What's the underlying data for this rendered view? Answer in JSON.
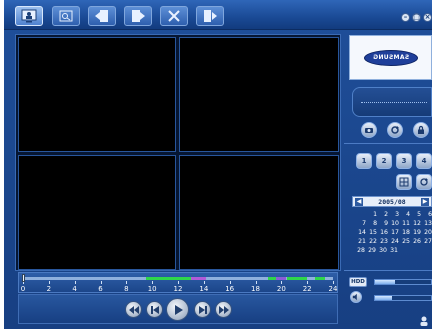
{
  "toolbar": {
    "buttons": [
      {
        "name": "live-view",
        "icon": "monitor-person-icon",
        "active": true
      },
      {
        "name": "search",
        "icon": "search-image-icon",
        "active": false
      },
      {
        "name": "backup",
        "icon": "backup-icon",
        "active": false
      },
      {
        "name": "export",
        "icon": "export-icon",
        "active": false
      },
      {
        "name": "setup",
        "icon": "tools-icon",
        "active": false
      },
      {
        "name": "exit",
        "icon": "exit-door-icon",
        "active": false
      }
    ],
    "window_controls": [
      "minimize",
      "maximize",
      "close"
    ]
  },
  "timeline": {
    "labels": [
      "0",
      "2",
      "4",
      "6",
      "8",
      "10",
      "12",
      "14",
      "16",
      "18",
      "20",
      "22",
      "24"
    ],
    "segments": [
      {
        "from": 9.5,
        "to": 13.0,
        "color": "#2fd64b"
      },
      {
        "from": 13.0,
        "to": 14.2,
        "color": "#b05bd8"
      },
      {
        "from": 19.0,
        "to": 19.6,
        "color": "#2fd64b"
      },
      {
        "from": 19.6,
        "to": 20.4,
        "color": "#8c5bd8"
      },
      {
        "from": 20.4,
        "to": 22.0,
        "color": "#2fd64b"
      },
      {
        "from": 22.6,
        "to": 23.4,
        "color": "#2fd64b"
      }
    ],
    "playhead": 0
  },
  "playback": {
    "buttons": [
      "fast-rewind",
      "step-back",
      "play",
      "step-forward",
      "fast-forward"
    ]
  },
  "brand": {
    "logo_text": "SAMSUNG"
  },
  "split_buttons": {
    "labels": [
      "1",
      "2",
      "3",
      "4"
    ]
  },
  "calendar": {
    "title": "2005/08",
    "weeks": [
      [
        "1",
        "2",
        "3",
        "4",
        "5",
        "6"
      ],
      [
        "7",
        "8",
        "9",
        "10",
        "11",
        "12",
        "13"
      ],
      [
        "14",
        "15",
        "16",
        "17",
        "18",
        "19",
        "20"
      ],
      [
        "21",
        "22",
        "23",
        "24",
        "25",
        "26",
        "27"
      ],
      [
        "28",
        "29",
        "30",
        "31"
      ]
    ]
  },
  "status": {
    "hdd_label": "HDD",
    "hdd_usage": 0.35,
    "volume_level": 0.3
  },
  "colors": {
    "panel_blue": "#1f4f9a",
    "record_green": "#2fd64b",
    "event_purple": "#b05bd8"
  }
}
